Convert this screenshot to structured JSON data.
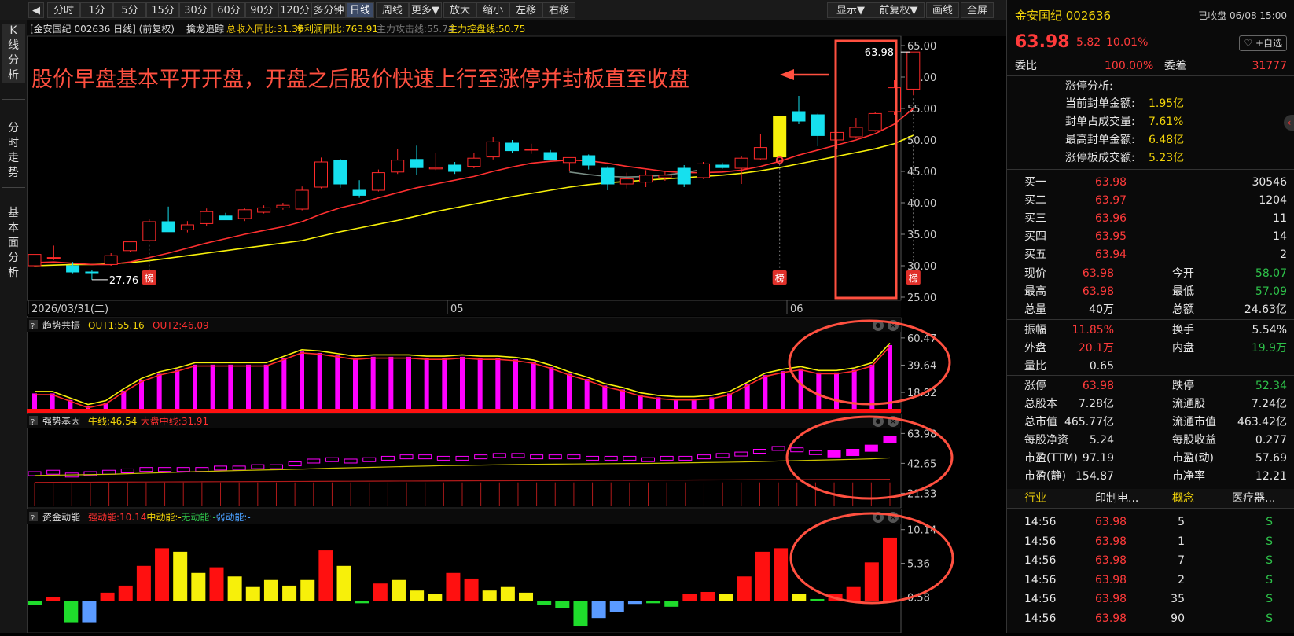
{
  "toolbar": {
    "collapse_icon": "collapse-left-icon",
    "periods": [
      "分时",
      "1分",
      "5分",
      "15分",
      "30分",
      "60分",
      "90分",
      "120分",
      "多分钟",
      "日线",
      "周线",
      "更多▼",
      "放大",
      "缩小",
      "左移",
      "右移"
    ],
    "active_period": "日线",
    "right_buttons": [
      "显示▼",
      "前复权▼",
      "画线",
      "全屏"
    ]
  },
  "sidebar": {
    "tabs": [
      {
        "label": "K线分析",
        "active": true
      },
      {
        "label": "分时走势",
        "active": false
      },
      {
        "label": "基本面分析",
        "active": false
      }
    ]
  },
  "main_chart": {
    "header_title": "[金安国纪 002636 日线] (前复权)",
    "indicator_name": "擒龙追踪",
    "indicator_values": [
      "总收入同比:31.36",
      "净利润同比:763.91",
      "主力攻击线:55.74",
      "主力控盘线:50.75"
    ],
    "annotation": "股价早盘基本平开开盘，开盘之后股价快速上行至涨停并封板直至收盘",
    "high_label": "63.98",
    "low_label": "27.76",
    "badge_label": "榜",
    "date_labels": [
      "2026/03/31(二)",
      "05",
      "06"
    ]
  },
  "chart_data": [
    {
      "type": "candlestick",
      "title": "[金安国纪 002636 日线] (前复权)",
      "yticks": [
        65,
        60,
        55,
        50,
        45,
        40,
        35,
        30,
        25
      ],
      "ylim": [
        24.5,
        66.5
      ],
      "grid": false,
      "candles": [
        {
          "o": 30.0,
          "h": 31.8,
          "l": 29.8,
          "c": 31.8
        },
        {
          "o": 31.3,
          "h": 33.2,
          "l": 30.9,
          "c": 31.3
        },
        {
          "o": 30.0,
          "h": 30.6,
          "l": 28.8,
          "c": 29.0
        },
        {
          "o": 29.0,
          "h": 29.3,
          "l": 27.76,
          "c": 28.9
        },
        {
          "o": 30.2,
          "h": 32.0,
          "l": 30.0,
          "c": 31.6
        },
        {
          "o": 32.4,
          "h": 33.8,
          "l": 32.2,
          "c": 33.8
        },
        {
          "o": 34.0,
          "h": 37.4,
          "l": 33.8,
          "c": 37.0
        },
        {
          "o": 37.0,
          "h": 39.4,
          "l": 36.6,
          "c": 35.4
        },
        {
          "o": 35.7,
          "h": 37.1,
          "l": 35.3,
          "c": 36.5
        },
        {
          "o": 36.7,
          "h": 39.1,
          "l": 36.3,
          "c": 38.6
        },
        {
          "o": 37.9,
          "h": 38.4,
          "l": 37.3,
          "c": 37.3
        },
        {
          "o": 37.5,
          "h": 39.1,
          "l": 37.1,
          "c": 38.9
        },
        {
          "o": 38.5,
          "h": 39.6,
          "l": 38.3,
          "c": 39.2
        },
        {
          "o": 39.2,
          "h": 40.0,
          "l": 38.9,
          "c": 39.6
        },
        {
          "o": 39.0,
          "h": 42.6,
          "l": 38.8,
          "c": 42.0
        },
        {
          "o": 42.5,
          "h": 47.2,
          "l": 42.3,
          "c": 46.5
        },
        {
          "o": 46.8,
          "h": 47.0,
          "l": 42.4,
          "c": 43.0
        },
        {
          "o": 42.0,
          "h": 43.6,
          "l": 40.8,
          "c": 41.2
        },
        {
          "o": 42.0,
          "h": 45.3,
          "l": 41.8,
          "c": 44.8
        },
        {
          "o": 44.9,
          "h": 48.5,
          "l": 44.6,
          "c": 46.8
        },
        {
          "o": 46.9,
          "h": 49.1,
          "l": 44.5,
          "c": 45.6
        },
        {
          "o": 45.4,
          "h": 47.9,
          "l": 45.2,
          "c": 45.6
        },
        {
          "o": 46.0,
          "h": 46.5,
          "l": 44.6,
          "c": 45.0
        },
        {
          "o": 45.8,
          "h": 47.9,
          "l": 45.5,
          "c": 47.1
        },
        {
          "o": 47.3,
          "h": 50.5,
          "l": 46.9,
          "c": 49.7
        },
        {
          "o": 49.5,
          "h": 50.0,
          "l": 48.0,
          "c": 48.3
        },
        {
          "o": 48.5,
          "h": 49.4,
          "l": 47.8,
          "c": 48.5
        },
        {
          "o": 48.0,
          "h": 48.4,
          "l": 46.8,
          "c": 46.8
        },
        {
          "o": 46.4,
          "h": 47.1,
          "l": 45.0,
          "c": 47.2
        },
        {
          "o": 47.5,
          "h": 47.7,
          "l": 45.3,
          "c": 46.0
        },
        {
          "o": 45.5,
          "h": 45.8,
          "l": 42.0,
          "c": 43.0
        },
        {
          "o": 43.0,
          "h": 44.8,
          "l": 42.3,
          "c": 43.8
        },
        {
          "o": 43.3,
          "h": 45.2,
          "l": 42.5,
          "c": 44.4
        },
        {
          "o": 44.0,
          "h": 45.0,
          "l": 43.5,
          "c": 44.4
        },
        {
          "o": 45.5,
          "h": 46.0,
          "l": 42.5,
          "c": 43.0
        },
        {
          "o": 44.0,
          "h": 46.5,
          "l": 43.8,
          "c": 46.2
        },
        {
          "o": 46.0,
          "h": 46.4,
          "l": 45.4,
          "c": 45.6
        },
        {
          "o": 45.5,
          "h": 47.5,
          "l": 43.0,
          "c": 47.1
        },
        {
          "o": 47.0,
          "h": 51.0,
          "l": 46.8,
          "c": 48.8
        },
        {
          "o": 47.3,
          "h": 53.7,
          "l": 47.3,
          "c": 53.7
        },
        {
          "o": 54.5,
          "h": 57.0,
          "l": 52.5,
          "c": 53.0
        },
        {
          "o": 54.0,
          "h": 54.2,
          "l": 49.0,
          "c": 50.7
        },
        {
          "o": 50.0,
          "h": 51.0,
          "l": 48.5,
          "c": 51.2
        },
        {
          "o": 50.5,
          "h": 53.5,
          "l": 50.2,
          "c": 52.0
        },
        {
          "o": 51.5,
          "h": 54.5,
          "l": 51.3,
          "c": 54.2
        },
        {
          "o": 54.5,
          "h": 59.5,
          "l": 54.0,
          "c": 58.3
        },
        {
          "o": 58.07,
          "h": 63.98,
          "l": 57.09,
          "c": 63.98
        }
      ],
      "ma_red": [
        30.5,
        30.6,
        30.4,
        30.2,
        30.2,
        30.6,
        31.3,
        32.0,
        32.8,
        33.6,
        34.3,
        35.0,
        35.6,
        36.2,
        37.0,
        38.2,
        39.2,
        39.9,
        40.8,
        41.6,
        42.4,
        43.0,
        43.6,
        44.2,
        45.0,
        45.7,
        46.3,
        46.6,
        46.8,
        46.7,
        46.3,
        45.8,
        45.4,
        45.0,
        44.8,
        44.8,
        44.9,
        45.2,
        45.8,
        46.6,
        47.6,
        48.4,
        49.2,
        50.0,
        51.0,
        52.5,
        55.0
      ],
      "ma_gray": [
        44.9,
        44.5,
        44.2,
        44.1,
        44.2,
        44.4,
        44.8,
        45.3
      ],
      "ma_yellow": [
        30.0,
        30.1,
        30.2,
        30.2,
        30.3,
        30.5,
        30.8,
        31.2,
        31.6,
        32.0,
        32.4,
        32.8,
        33.2,
        33.6,
        34.0,
        34.7,
        35.4,
        36.0,
        36.6,
        37.2,
        37.9,
        38.6,
        39.2,
        39.8,
        40.4,
        41.0,
        41.5,
        42.0,
        42.5,
        42.9,
        43.2,
        43.4,
        43.6,
        43.8,
        44.0,
        44.2,
        44.4,
        44.7,
        45.1,
        45.6,
        46.2,
        46.8,
        47.4,
        48.0,
        48.6,
        49.4,
        50.75
      ]
    },
    {
      "type": "bar",
      "title": "趋势共振",
      "legend": [
        "OUT1:55.16",
        "OUT2:46.09"
      ],
      "yticks": [
        60.47,
        39.64,
        18.82
      ],
      "ylim": [
        5,
        64
      ],
      "values": [
        18,
        18,
        13,
        8,
        11,
        20,
        28,
        33,
        36,
        40,
        40,
        40,
        40,
        40,
        45,
        50,
        49,
        47,
        45,
        46,
        46,
        46,
        45,
        45,
        46,
        45,
        45,
        44,
        42,
        38,
        33,
        29,
        24,
        21,
        17,
        15,
        14,
        14,
        15,
        18,
        25,
        32,
        35,
        37,
        34,
        34,
        36,
        40,
        55
      ]
    },
    {
      "type": "bar",
      "title": "强势基因",
      "legend": [
        "牛线:46.54",
        "大盘中线:31.91"
      ],
      "yticks": [
        63.98,
        42.65,
        21.33
      ],
      "ylim": [
        12,
        67
      ],
      "values": [
        35,
        36,
        34,
        35,
        36,
        37,
        38,
        38,
        38,
        38,
        39,
        39,
        40,
        40,
        42,
        44,
        45,
        44,
        45,
        46,
        47,
        47,
        46,
        46,
        47,
        48,
        48,
        47,
        47,
        47,
        46,
        46,
        46,
        45,
        46,
        46,
        47,
        48,
        49,
        51,
        53,
        52,
        50,
        50,
        51,
        54,
        60
      ],
      "bull_line": [
        34,
        34.2,
        34.4,
        34.6,
        34.8,
        35.2,
        35.6,
        36,
        36.4,
        36.8,
        37.2,
        37.5,
        37.8,
        38.1,
        38.4,
        38.8,
        39.2,
        39.5,
        39.8,
        40.1,
        40.4,
        40.7,
        41,
        41.2,
        41.4,
        41.6,
        41.8,
        42,
        42.1,
        42.2,
        42.3,
        42.4,
        42.5,
        42.6,
        42.8,
        43,
        43.2,
        43.4,
        43.6,
        43.9,
        44.3,
        44.6,
        44.9,
        45.2,
        45.5,
        45.9,
        46.54
      ]
    },
    {
      "type": "bar",
      "title": "资金动能",
      "legend": [
        "强动能:10.14",
        "中动能:-",
        "无动能:-",
        "弱动能:-"
      ],
      "yticks": [
        10.14,
        5.36,
        0.58
      ],
      "ylim": [
        -4.5,
        11
      ],
      "values": [
        -0.5,
        0.6,
        -3.0,
        -3.0,
        1.2,
        2.2,
        5.0,
        7.5,
        7.0,
        4.0,
        4.8,
        3.5,
        2.0,
        3.0,
        2.2,
        3.0,
        7.2,
        5.0,
        -0.3,
        2.5,
        3.0,
        1.5,
        1.0,
        4.0,
        3.2,
        1.5,
        2.0,
        1.2,
        -0.5,
        -1.0,
        -3.5,
        -2.4,
        -1.5,
        -0.4,
        -0.3,
        -0.8,
        1.0,
        1.3,
        1.0,
        3.5,
        7.0,
        7.5,
        1.0,
        0.3,
        1.0,
        2.0,
        5.5,
        9.0
      ],
      "colors": [
        "green",
        "red",
        "green",
        "blue",
        "red",
        "red",
        "red",
        "red",
        "yellow",
        "yellow",
        "red",
        "yellow",
        "yellow",
        "yellow",
        "yellow",
        "yellow",
        "red",
        "yellow",
        "green",
        "red",
        "yellow",
        "yellow",
        "yellow",
        "red",
        "red",
        "yellow",
        "yellow",
        "yellow",
        "green",
        "green",
        "green",
        "blue",
        "blue",
        "blue",
        "green",
        "green",
        "red",
        "red",
        "yellow",
        "red",
        "red",
        "red",
        "yellow",
        "green",
        "red",
        "red",
        "red",
        "red"
      ]
    }
  ],
  "right_panel": {
    "stock_title": "金安国纪 002636",
    "status": "已收盘 06/08 15:00",
    "price": "63.98",
    "change": "5.82",
    "change_pct": "10.01%",
    "add_button": "+自选",
    "weibi_label": "委比",
    "weibi_value": "100.00%",
    "weicha_label": "委差",
    "weicha_value": "31777",
    "limit_title": "涨停分析:",
    "limit_rows": [
      {
        "label": "当前封单金额:",
        "value": "1.95亿"
      },
      {
        "label": "封单占成交量:",
        "value": "7.61%"
      },
      {
        "label": "最高封单金额:",
        "value": "6.48亿"
      },
      {
        "label": "涨停板成交额:",
        "value": "5.23亿"
      }
    ],
    "bids": [
      {
        "label": "买一",
        "price": "63.98",
        "vol": "30546"
      },
      {
        "label": "买二",
        "price": "63.97",
        "vol": "1204"
      },
      {
        "label": "买三",
        "price": "63.96",
        "vol": "11"
      },
      {
        "label": "买四",
        "price": "63.95",
        "vol": "14"
      },
      {
        "label": "买五",
        "price": "63.94",
        "vol": "2"
      }
    ],
    "stats": [
      {
        "l1": "现价",
        "v1": "63.98",
        "c1": "red",
        "l2": "今开",
        "v2": "58.07",
        "c2": "green"
      },
      {
        "l1": "最高",
        "v1": "63.98",
        "c1": "red",
        "l2": "最低",
        "v2": "57.09",
        "c2": "green"
      },
      {
        "l1": "总量",
        "v1": "40万",
        "c1": "white",
        "l2": "总额",
        "v2": "24.63亿",
        "c2": "white"
      },
      {
        "l1": "振幅",
        "v1": "11.85%",
        "c1": "red",
        "l2": "换手",
        "v2": "5.54%",
        "c2": "white"
      },
      {
        "l1": "外盘",
        "v1": "20.1万",
        "c1": "red",
        "l2": "内盘",
        "v2": "19.9万",
        "c2": "green"
      },
      {
        "l1": "量比",
        "v1": "0.65",
        "c1": "white",
        "l2": "",
        "v2": "",
        "c2": "white"
      },
      {
        "l1": "涨停",
        "v1": "63.98",
        "c1": "red",
        "l2": "跌停",
        "v2": "52.34",
        "c2": "green"
      },
      {
        "l1": "总股本",
        "v1": "7.28亿",
        "c1": "white",
        "l2": "流通股",
        "v2": "7.24亿",
        "c2": "white"
      },
      {
        "l1": "总市值",
        "v1": "465.77亿",
        "c1": "white",
        "l2": "流通市值",
        "v2": "463.42亿",
        "c2": "white"
      },
      {
        "l1": "每股净资",
        "v1": "5.24",
        "c1": "white",
        "l2": "每股收益",
        "v2": "0.277",
        "c2": "white"
      },
      {
        "l1": "市盈(TTM)",
        "v1": "97.19",
        "c1": "white",
        "l2": "市盈(动)",
        "v2": "57.69",
        "c2": "white"
      },
      {
        "l1": "市盈(静)",
        "v1": "154.87",
        "c1": "white",
        "l2": "市净率",
        "v2": "12.21",
        "c2": "white"
      }
    ],
    "industry_label": "行业",
    "industry_value": "印制电...",
    "concept_label": "概念",
    "concept_value": "医疗器...",
    "ticks": [
      {
        "time": "14:56",
        "price": "63.98",
        "vol": "5",
        "dir": "S"
      },
      {
        "time": "14:56",
        "price": "63.98",
        "vol": "1",
        "dir": "S"
      },
      {
        "time": "14:56",
        "price": "63.98",
        "vol": "7",
        "dir": "S"
      },
      {
        "time": "14:56",
        "price": "63.98",
        "vol": "2",
        "dir": "S"
      },
      {
        "time": "14:56",
        "price": "63.98",
        "vol": "35",
        "dir": "S"
      },
      {
        "time": "14:56",
        "price": "63.98",
        "vol": "90",
        "dir": "S"
      }
    ]
  }
}
